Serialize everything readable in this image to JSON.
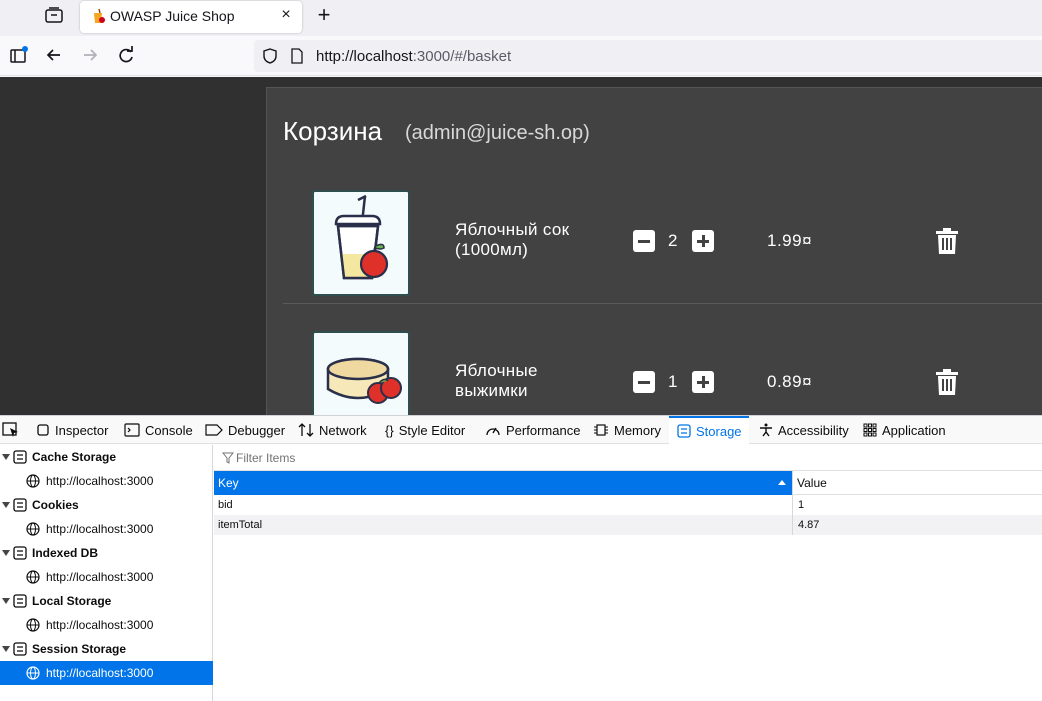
{
  "browser": {
    "tab_title": "OWASP Juice Shop",
    "new_tab": "+",
    "close_tab": "×",
    "url_host": "http://localhost",
    "url_rest": ":3000/#/basket"
  },
  "basket": {
    "title": "Корзина",
    "user": "(admin@juice-sh.op)",
    "items": [
      {
        "name": "Яблочный сок (1000мл)",
        "quantity": "2",
        "price": "1.99¤"
      },
      {
        "name": "Яблочные выжимки",
        "quantity": "1",
        "price": "0.89¤"
      }
    ]
  },
  "devtools": {
    "tabs": [
      "Inspector",
      "Console",
      "Debugger",
      "Network",
      "Style Editor",
      "Performance",
      "Memory",
      "Storage",
      "Accessibility",
      "Application"
    ],
    "selected_tab": "Storage",
    "tree": [
      {
        "category": "Cache Storage",
        "host": "http://localhost:3000"
      },
      {
        "category": "Cookies",
        "host": "http://localhost:3000"
      },
      {
        "category": "Indexed DB",
        "host": "http://localhost:3000"
      },
      {
        "category": "Local Storage",
        "host": "http://localhost:3000"
      },
      {
        "category": "Session Storage",
        "host": "http://localhost:3000"
      }
    ],
    "filter_placeholder": "Filter Items",
    "columns": {
      "key": "Key",
      "value": "Value"
    },
    "rows": [
      {
        "key": "bid",
        "value": "1"
      },
      {
        "key": "itemTotal",
        "value": "4.87"
      }
    ]
  },
  "colors": {
    "accent": "#0074e8",
    "page_bg": "#303030",
    "card_bg": "#424242"
  }
}
